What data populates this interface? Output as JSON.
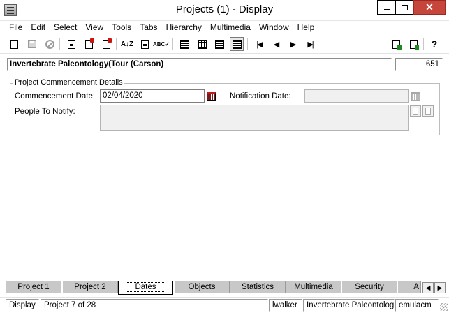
{
  "window": {
    "title": "Projects (1) - Display",
    "close_glyph": "✕"
  },
  "menu": [
    "File",
    "Edit",
    "Select",
    "View",
    "Tools",
    "Tabs",
    "Hierarchy",
    "Multimedia",
    "Window",
    "Help"
  ],
  "toolbar": {
    "icons": [
      "new-doc-icon",
      "save-icon",
      "cancel-icon",
      "edit-doc-icon",
      "delete-doc-icon",
      "copy-doc-icon",
      "sort-az-icon",
      "notes-icon",
      "spellcheck-icon",
      "list-view-icon",
      "grid-view-icon",
      "detail-view-icon",
      "record-view-icon",
      "first-record-icon",
      "previous-record-icon",
      "next-record-icon",
      "last-record-icon",
      "attach-icon",
      "attach-green-icon",
      "help-context-icon"
    ],
    "sort_label": "A↓Z",
    "spell_label": "ABC✓",
    "help_label": "?",
    "nav": {
      "first": "|◀",
      "prev": "◀",
      "next": "▶",
      "last": "▶|"
    }
  },
  "record": {
    "title": "Invertebrate Paleontology(Tour (Carson)",
    "number": "651"
  },
  "group": {
    "legend": "Project Commencement Details",
    "commencement_label": "Commencement Date:",
    "commencement_value": "02/04/2020",
    "notification_label": "Notification Date:",
    "notification_value": "",
    "people_label": "People To Notify:",
    "people_value": ""
  },
  "tabs": [
    {
      "label": "Project 1",
      "active": false
    },
    {
      "label": "Project 2",
      "active": false
    },
    {
      "label": "Dates",
      "active": true
    },
    {
      "label": "Objects",
      "active": false
    },
    {
      "label": "Statistics",
      "active": false
    },
    {
      "label": "Multimedia",
      "active": false
    },
    {
      "label": "Security",
      "active": false
    },
    {
      "label": "A",
      "active": false
    }
  ],
  "tab_scroll": {
    "left": "◀",
    "right": "▶"
  },
  "status": {
    "mode": "Display",
    "position": "Project 7 of 28",
    "user": "lwalker",
    "department": "Invertebrate Paleontology",
    "database": "emulacm"
  },
  "colors": {
    "close_button": "#c7463b",
    "tab_inactive": "#c8c8c8",
    "calendar_red": "#c01c1c"
  }
}
